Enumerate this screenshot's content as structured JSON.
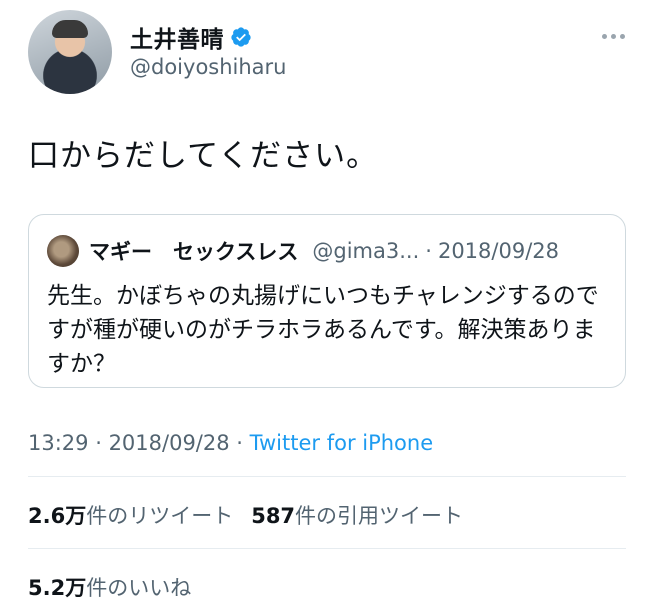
{
  "author": {
    "display_name": "土井善晴",
    "handle": "@doiyoshiharu",
    "verified": true,
    "avatar_icon": "user-avatar"
  },
  "tweet": {
    "text": "口からだしてください。"
  },
  "quoted_tweet": {
    "display_name": "マギー　セックスレス",
    "handle": "@gima3...",
    "date": "2018/09/28",
    "text": "先生。かぼちゃの丸揚げにいつもチャレンジするのですが種が硬いのがチラホラあるんです。解決策ありますか？"
  },
  "meta": {
    "time": "13:29",
    "date": "2018/09/28",
    "source": "Twitter for iPhone",
    "separator": " · "
  },
  "stats": {
    "retweets_count": "2.6万",
    "retweets_label": "件のリツイート",
    "quotes_count": "587",
    "quotes_label": "件の引用ツイート",
    "likes_count": "5.2万",
    "likes_label": "件のいいね"
  },
  "colors": {
    "accent": "#1d9bf0",
    "secondary_text": "#536471",
    "border": "#cfd9de"
  }
}
